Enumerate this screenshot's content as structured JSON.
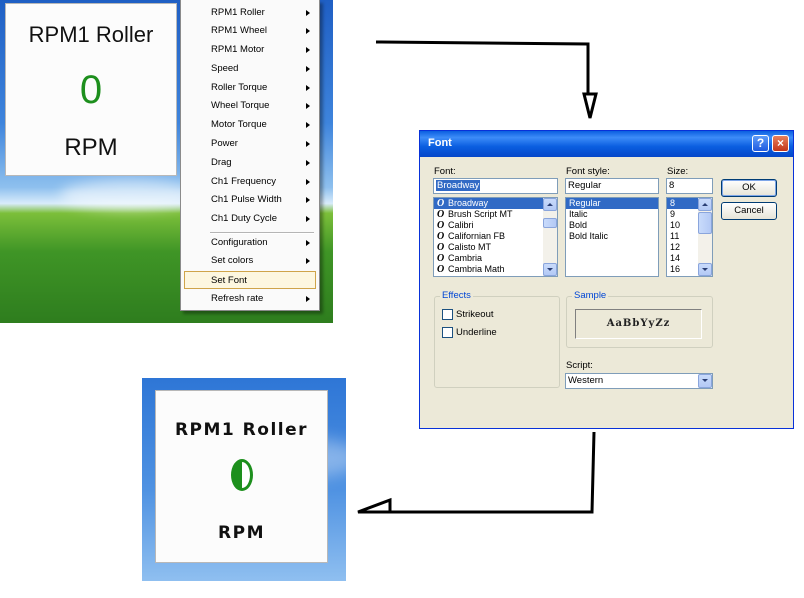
{
  "top_gauge": {
    "title": "RPM1 Roller",
    "value": "0",
    "unit": "RPM"
  },
  "context_menu": {
    "items": [
      {
        "label": "RPM1 Roller",
        "submenu": true
      },
      {
        "label": "RPM1 Wheel",
        "submenu": true
      },
      {
        "label": "RPM1 Motor",
        "submenu": true
      },
      {
        "label": "Speed",
        "submenu": true
      },
      {
        "label": "Roller Torque",
        "submenu": true
      },
      {
        "label": "Wheel Torque",
        "submenu": true
      },
      {
        "label": "Motor Torque",
        "submenu": true
      },
      {
        "label": "Power",
        "submenu": true
      },
      {
        "label": "Drag",
        "submenu": true
      },
      {
        "label": "Ch1 Frequency",
        "submenu": true
      },
      {
        "label": "Ch1 Pulse Width",
        "submenu": true
      },
      {
        "label": "Ch1 Duty Cycle",
        "submenu": true
      },
      {
        "label": "Configuration",
        "submenu": true
      },
      {
        "label": "Set colors",
        "submenu": true
      },
      {
        "label": "Set Font",
        "submenu": false
      },
      {
        "label": "Refresh rate",
        "submenu": true
      }
    ],
    "selected": "Set Font"
  },
  "font_dialog": {
    "title": "Font",
    "help_label": "?",
    "close_label": "×",
    "font_label": "Font:",
    "font_value": "Broadway",
    "font_list": [
      "Broadway",
      "Brush Script MT",
      "Calibri",
      "Californian FB",
      "Calisto MT",
      "Cambria",
      "Cambria Math"
    ],
    "style_label": "Font style:",
    "style_value": "Regular",
    "style_list": [
      "Regular",
      "Italic",
      "Bold",
      "Bold Italic"
    ],
    "size_label": "Size:",
    "size_value": "8",
    "size_list": [
      "8",
      "9",
      "10",
      "11",
      "12",
      "14",
      "16"
    ],
    "ok_label": "OK",
    "cancel_label": "Cancel",
    "effects_label": "Effects",
    "strikeout_label": "Strikeout",
    "underline_label": "Underline",
    "sample_label": "Sample",
    "sample_text": "AaBbYyZz",
    "script_label": "Script:",
    "script_value": "Western",
    "selection_color": "#316ac5"
  },
  "result_gauge": {
    "title": "RPM1 Roller",
    "value": "0",
    "unit": "RPM",
    "value_color": "#1d8f1d"
  }
}
